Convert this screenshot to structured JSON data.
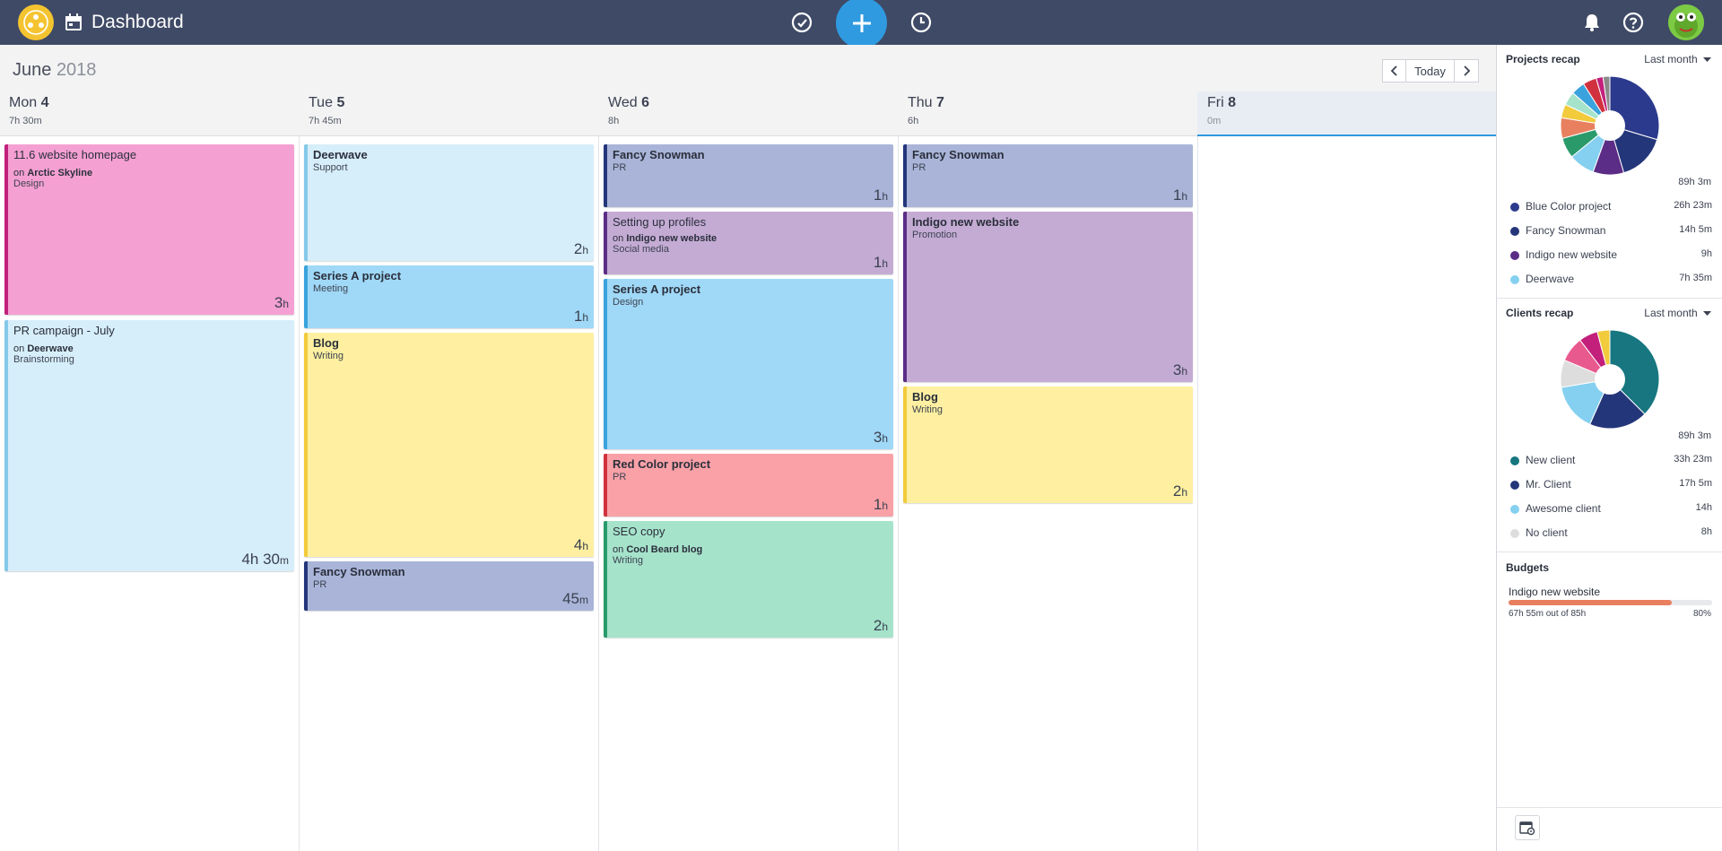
{
  "app": {
    "title": "Dashboard"
  },
  "calendar": {
    "month": "June",
    "year": "2018",
    "today_label": "Today",
    "days": [
      {
        "name": "Mon",
        "num": "4",
        "total": "7h 30m"
      },
      {
        "name": "Tue",
        "num": "5",
        "total": "7h 45m"
      },
      {
        "name": "Wed",
        "num": "6",
        "total": "8h"
      },
      {
        "name": "Thu",
        "num": "7",
        "total": "6h"
      },
      {
        "name": "Fri",
        "num": "8",
        "total": "0m"
      }
    ],
    "events": [
      {
        "title": "11.6 website homepage",
        "on": "on",
        "project": "Arctic Skyline",
        "sub": "Design",
        "dur": "3",
        "unit": "h"
      },
      {
        "title": "PR campaign - July",
        "on": "on",
        "project": "Deerwave",
        "sub": "Brainstorming",
        "dur": "4h 30",
        "unit": "m"
      },
      {
        "title": "Deerwave",
        "sub": "Support",
        "dur": "2",
        "unit": "h"
      },
      {
        "title": "Series A project",
        "sub": "Meeting",
        "dur": "1",
        "unit": "h"
      },
      {
        "title": "Blog",
        "sub": "Writing",
        "dur": "4",
        "unit": "h"
      },
      {
        "title": "Fancy Snowman",
        "sub": "PR",
        "dur": "45",
        "unit": "m"
      },
      {
        "title": "Fancy Snowman",
        "sub": "PR",
        "dur": "1",
        "unit": "h"
      },
      {
        "title": "Setting up profiles",
        "on": "on",
        "project": "Indigo new website",
        "sub": "Social media",
        "dur": "1",
        "unit": "h"
      },
      {
        "title": "Series A project",
        "sub": "Design",
        "dur": "3",
        "unit": "h"
      },
      {
        "title": "Red Color project",
        "sub": "PR",
        "dur": "1",
        "unit": "h"
      },
      {
        "title": "SEO copy",
        "on": "on",
        "project": "Cool Beard blog",
        "sub": "Writing",
        "dur": "2",
        "unit": "h"
      },
      {
        "title": "Fancy Snowman",
        "sub": "PR",
        "dur": "1",
        "unit": "h"
      },
      {
        "title": "Indigo new website",
        "sub": "Promotion",
        "dur": "3",
        "unit": "h"
      },
      {
        "title": "Blog",
        "sub": "Writing",
        "dur": "2",
        "unit": "h"
      }
    ]
  },
  "sidebar": {
    "projects": {
      "title": "Projects recap",
      "range": "Last month",
      "total": "89h 3m",
      "items": [
        {
          "name": "Blue Color project",
          "value": "26h 23m",
          "color": "#2b3a8c"
        },
        {
          "name": "Fancy Snowman",
          "value": "14h 5m",
          "color": "#24367a"
        },
        {
          "name": "Indigo new website",
          "value": "9h",
          "color": "#5b2d86"
        },
        {
          "name": "Deerwave",
          "value": "7h 35m",
          "color": "#85d0f0"
        }
      ]
    },
    "clients": {
      "title": "Clients recap",
      "range": "Last month",
      "total": "89h 3m",
      "items": [
        {
          "name": "New client",
          "value": "33h 23m",
          "color": "#177680"
        },
        {
          "name": "Mr. Client",
          "value": "17h 5m",
          "color": "#24367a"
        },
        {
          "name": "Awesome client",
          "value": "14h",
          "color": "#85d0f0"
        },
        {
          "name": "No client",
          "value": "8h",
          "color": "#dddddd"
        }
      ]
    },
    "budgets": {
      "title": "Budgets",
      "project": "Indigo new website",
      "used": "67h 55m out of 85h",
      "percent_label": "80%",
      "fraction": 0.8
    }
  }
}
